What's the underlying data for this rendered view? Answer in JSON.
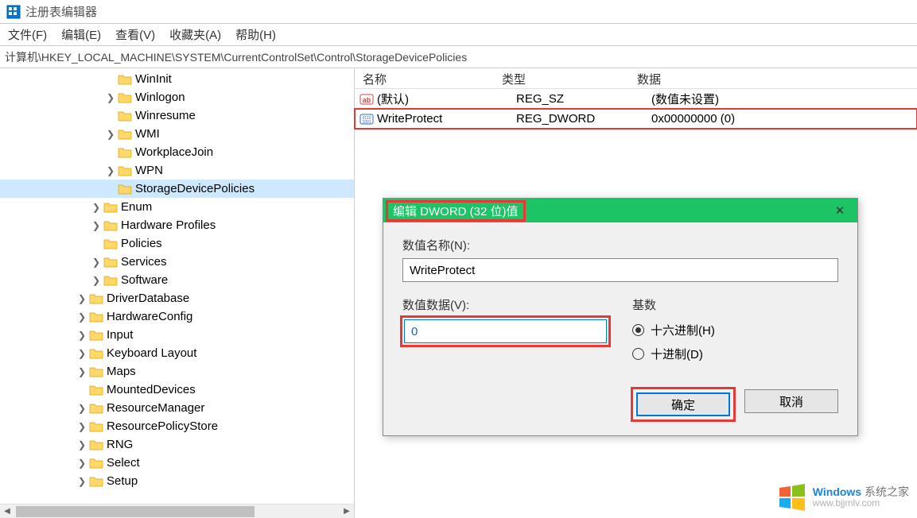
{
  "window": {
    "title": "注册表编辑器"
  },
  "menu": {
    "file": "文件(F)",
    "edit": "编辑(E)",
    "view": "查看(V)",
    "favorites": "收藏夹(A)",
    "help": "帮助(H)"
  },
  "path": "计算机\\HKEY_LOCAL_MACHINE\\SYSTEM\\CurrentControlSet\\Control\\StorageDevicePolicies",
  "tree": [
    {
      "indent": 7,
      "expander": "",
      "label": "WinInit"
    },
    {
      "indent": 7,
      "expander": "❯",
      "label": "Winlogon"
    },
    {
      "indent": 7,
      "expander": "",
      "label": "Winresume"
    },
    {
      "indent": 7,
      "expander": "❯",
      "label": "WMI"
    },
    {
      "indent": 7,
      "expander": "",
      "label": "WorkplaceJoin"
    },
    {
      "indent": 7,
      "expander": "❯",
      "label": "WPN"
    },
    {
      "indent": 7,
      "expander": "",
      "label": "StorageDevicePolicies",
      "selected": true
    },
    {
      "indent": 6,
      "expander": "❯",
      "label": "Enum"
    },
    {
      "indent": 6,
      "expander": "❯",
      "label": "Hardware Profiles"
    },
    {
      "indent": 6,
      "expander": "",
      "label": "Policies"
    },
    {
      "indent": 6,
      "expander": "❯",
      "label": "Services"
    },
    {
      "indent": 6,
      "expander": "❯",
      "label": "Software"
    },
    {
      "indent": 5,
      "expander": "❯",
      "label": "DriverDatabase"
    },
    {
      "indent": 5,
      "expander": "❯",
      "label": "HardwareConfig"
    },
    {
      "indent": 5,
      "expander": "❯",
      "label": "Input"
    },
    {
      "indent": 5,
      "expander": "❯",
      "label": "Keyboard Layout"
    },
    {
      "indent": 5,
      "expander": "❯",
      "label": "Maps"
    },
    {
      "indent": 5,
      "expander": "",
      "label": "MountedDevices"
    },
    {
      "indent": 5,
      "expander": "❯",
      "label": "ResourceManager"
    },
    {
      "indent": 5,
      "expander": "❯",
      "label": "ResourcePolicyStore"
    },
    {
      "indent": 5,
      "expander": "❯",
      "label": "RNG"
    },
    {
      "indent": 5,
      "expander": "❯",
      "label": "Select"
    },
    {
      "indent": 5,
      "expander": "❯",
      "label": "Setup"
    }
  ],
  "values_header": {
    "name": "名称",
    "type": "类型",
    "data": "数据"
  },
  "values": [
    {
      "icon": "ab",
      "name": "(默认)",
      "type": "REG_SZ",
      "data": "(数值未设置)",
      "highlighted": false
    },
    {
      "icon": "0110",
      "name": "WriteProtect",
      "type": "REG_DWORD",
      "data": "0x00000000 (0)",
      "highlighted": true
    }
  ],
  "dialog": {
    "title": "编辑 DWORD (32 位)值",
    "name_label": "数值名称(N):",
    "name_value": "WriteProtect",
    "data_label": "数值数据(V):",
    "data_value": "0",
    "base_label": "基数",
    "radio_hex": "十六进制(H)",
    "radio_dec": "十进制(D)",
    "ok": "确定",
    "cancel": "取消"
  },
  "watermark": {
    "brand1": "Windows",
    "brand2": " 系统之家",
    "url": "www.bjjmlv.com"
  }
}
